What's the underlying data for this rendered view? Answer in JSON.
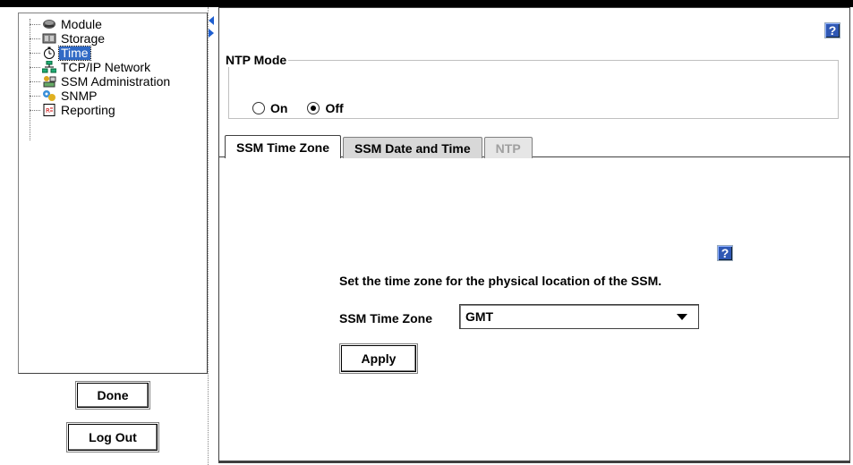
{
  "tree": {
    "items": [
      {
        "label": "Module",
        "icon": "module-icon",
        "selected": false
      },
      {
        "label": "Storage",
        "icon": "storage-icon",
        "selected": false
      },
      {
        "label": "Time",
        "icon": "clock-icon",
        "selected": true
      },
      {
        "label": "TCP/IP Network",
        "icon": "network-icon",
        "selected": false
      },
      {
        "label": "SSM Administration",
        "icon": "admin-icon",
        "selected": false
      },
      {
        "label": "SNMP",
        "icon": "snmp-icon",
        "selected": false
      },
      {
        "label": "Reporting",
        "icon": "reporting-icon",
        "selected": false
      }
    ]
  },
  "buttons": {
    "done": "Done",
    "logout": "Log Out",
    "apply": "Apply"
  },
  "help": {
    "glyph": "?"
  },
  "ntp_mode": {
    "legend": "NTP Mode",
    "options": [
      {
        "label": "On",
        "checked": false
      },
      {
        "label": "Off",
        "checked": true
      }
    ]
  },
  "tabs": [
    {
      "label": "SSM Time Zone",
      "state": "active"
    },
    {
      "label": "SSM Date and Time",
      "state": "normal"
    },
    {
      "label": "NTP",
      "state": "disabled"
    }
  ],
  "time_zone_panel": {
    "description": "Set the time zone for the physical location of the SSM.",
    "field_label": "SSM Time Zone",
    "selected_value": "GMT"
  },
  "colors": {
    "selection": "#316ac5",
    "help_button": "#2f58b4",
    "splitter_arrow": "#1f5fd0"
  }
}
